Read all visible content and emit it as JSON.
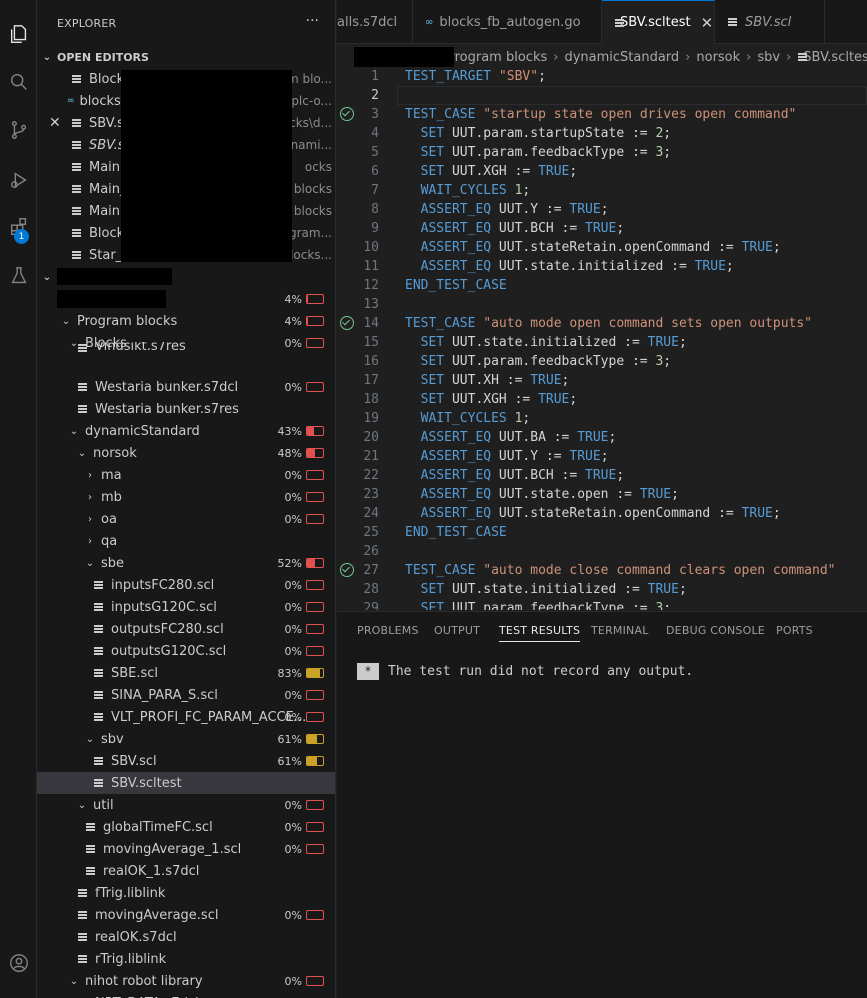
{
  "sidebar": {
    "title": "EXPLORER",
    "more": "···",
    "open_editors_title": "OPEN EDITORS",
    "open_editors": [
      {
        "name": "Block",
        "desc": "m blo...",
        "icon": "file"
      },
      {
        "name": "blocks",
        "desc": ".plc-o...",
        "icon": "go"
      },
      {
        "name": "SBV.sc",
        "desc": "ocks\\d...",
        "icon": "file",
        "close": "✕"
      },
      {
        "name": "SBV.sc",
        "desc": "ynami...",
        "icon": "file"
      },
      {
        "name": "Main.s",
        "desc": "ocks",
        "icon": "file"
      },
      {
        "name": "Main_",
        "desc": "n blocks",
        "icon": "file"
      },
      {
        "name": "Main c",
        "desc": "n blocks",
        "icon": "file"
      },
      {
        "name": "Block",
        "desc": "rogram...",
        "icon": "file"
      },
      {
        "name": "Star_d",
        "desc": "blocks...",
        "icon": "file"
      }
    ],
    "tree": [
      {
        "label": "",
        "pct": "4%",
        "fill": 0.04,
        "color": "red",
        "twisty": "⌄",
        "indent": 16
      },
      {
        "label": "Program blocks",
        "pct": "4%",
        "fill": 0.04,
        "color": "red",
        "twisty": "⌄",
        "indent": 22
      },
      {
        "label": "Blocks",
        "pct": "0%",
        "fill": 0,
        "color": "red",
        "twisty": "⌄",
        "indent": 30
      },
      {
        "label": "Vindsikt.s7res",
        "pct": "",
        "indent": 40,
        "file": true,
        "partial": true
      },
      {
        "label": "Westaria bunker.s7dcl",
        "pct": "0%",
        "fill": 0,
        "color": "red",
        "indent": 40,
        "file": true
      },
      {
        "label": "Westaria bunker.s7res",
        "pct": "",
        "indent": 40,
        "file": true
      },
      {
        "label": "dynamicStandard",
        "pct": "43%",
        "fill": 0.43,
        "color": "red",
        "twisty": "⌄",
        "indent": 30
      },
      {
        "label": "norsok",
        "pct": "48%",
        "fill": 0.48,
        "color": "red",
        "twisty": "⌄",
        "indent": 38
      },
      {
        "label": "ma",
        "pct": "0%",
        "fill": 0,
        "color": "red",
        "twisty": "›",
        "indent": 46
      },
      {
        "label": "mb",
        "pct": "0%",
        "fill": 0,
        "color": "red",
        "twisty": "›",
        "indent": 46
      },
      {
        "label": "oa",
        "pct": "0%",
        "fill": 0,
        "color": "red",
        "twisty": "›",
        "indent": 46
      },
      {
        "label": "qa",
        "pct": "",
        "twisty": "›",
        "indent": 46
      },
      {
        "label": "sbe",
        "pct": "52%",
        "fill": 0.52,
        "color": "red",
        "twisty": "⌄",
        "indent": 46
      },
      {
        "label": "inputsFC280.scl",
        "pct": "0%",
        "fill": 0,
        "color": "red",
        "indent": 56,
        "file": true
      },
      {
        "label": "inputsG120C.scl",
        "pct": "0%",
        "fill": 0,
        "color": "red",
        "indent": 56,
        "file": true
      },
      {
        "label": "outputsFC280.scl",
        "pct": "0%",
        "fill": 0,
        "color": "red",
        "indent": 56,
        "file": true
      },
      {
        "label": "outputsG120C.scl",
        "pct": "0%",
        "fill": 0,
        "color": "red",
        "indent": 56,
        "file": true
      },
      {
        "label": "SBE.scl",
        "pct": "83%",
        "fill": 0.83,
        "color": "yellow",
        "indent": 56,
        "file": true
      },
      {
        "label": "SINA_PARA_S.scl",
        "pct": "0%",
        "fill": 0,
        "color": "red",
        "indent": 56,
        "file": true
      },
      {
        "label": "VLT_PROFI_FC_PARAM_ACCE...",
        "pct": "0%",
        "fill": 0,
        "color": "red",
        "indent": 56,
        "file": true
      },
      {
        "label": "sbv",
        "pct": "61%",
        "fill": 0.61,
        "color": "yellow",
        "twisty": "⌄",
        "indent": 46
      },
      {
        "label": "SBV.scl",
        "pct": "61%",
        "fill": 0.61,
        "color": "yellow",
        "indent": 56,
        "file": true
      },
      {
        "label": "SBV.scltest",
        "pct": "",
        "indent": 56,
        "file": true,
        "selected": true
      },
      {
        "label": "util",
        "pct": "0%",
        "fill": 0,
        "color": "red",
        "twisty": "⌄",
        "indent": 38
      },
      {
        "label": "globalTimeFC.scl",
        "pct": "0%",
        "fill": 0,
        "color": "red",
        "indent": 48,
        "file": true
      },
      {
        "label": "movingAverage_1.scl",
        "pct": "0%",
        "fill": 0,
        "color": "red",
        "indent": 48,
        "file": true
      },
      {
        "label": "realOK_1.s7dcl",
        "pct": "",
        "indent": 48,
        "file": true
      },
      {
        "label": "fTrig.liblink",
        "pct": "",
        "indent": 40,
        "file": true
      },
      {
        "label": "movingAverage.scl",
        "pct": "0%",
        "fill": 0,
        "color": "red",
        "indent": 40,
        "file": true
      },
      {
        "label": "realOK.s7dcl",
        "pct": "",
        "indent": 40,
        "file": true
      },
      {
        "label": "rTrig.liblink",
        "pct": "",
        "indent": 40,
        "file": true
      },
      {
        "label": "nihot robot library",
        "pct": "0%",
        "fill": 0,
        "color": "red",
        "twisty": "⌄",
        "indent": 30
      },
      {
        "label": "NRT_DATA.s7dcl",
        "pct": "0%",
        "fill": 0,
        "color": "red",
        "indent": 40,
        "file": true,
        "partial": true
      }
    ]
  },
  "tabs": [
    {
      "label": "alls.s7dcl",
      "icon": ""
    },
    {
      "label": "blocks_fb_autogen.go",
      "icon": "go"
    },
    {
      "label": "SBV.scltest",
      "icon": "file",
      "active": true,
      "close": "✕"
    },
    {
      "label": "SBV.scl",
      "icon": "file",
      "italic": true
    }
  ],
  "breadcrumb": [
    "Program blocks",
    "dynamicStandard",
    "norsok",
    "sbv",
    "SBV.scltest"
  ],
  "code": [
    {
      "n": "1",
      "t": [
        [
          "kw",
          "TEST_TARGET"
        ],
        [
          "tx",
          " "
        ],
        [
          "str",
          "\"SBV\""
        ],
        [
          "tx",
          ";"
        ]
      ]
    },
    {
      "n": "2",
      "t": [],
      "cur": true
    },
    {
      "n": "3",
      "check": true,
      "t": [
        [
          "kw",
          "TEST_CASE"
        ],
        [
          "tx",
          " "
        ],
        [
          "str",
          "\"startup state open drives open command\""
        ]
      ]
    },
    {
      "n": "4",
      "t": [
        [
          "tx",
          "  "
        ],
        [
          "kw",
          "SET"
        ],
        [
          "tx",
          " UUT.param.startupState := "
        ],
        [
          "nm",
          "2"
        ],
        [
          "tx",
          ";"
        ]
      ]
    },
    {
      "n": "5",
      "t": [
        [
          "tx",
          "  "
        ],
        [
          "kw",
          "SET"
        ],
        [
          "tx",
          " UUT.param.feedbackType := "
        ],
        [
          "nm",
          "3"
        ],
        [
          "tx",
          ";"
        ]
      ]
    },
    {
      "n": "6",
      "t": [
        [
          "tx",
          "  "
        ],
        [
          "kw",
          "SET"
        ],
        [
          "tx",
          " UUT.XGH := "
        ],
        [
          "cn",
          "TRUE"
        ],
        [
          "tx",
          ";"
        ]
      ]
    },
    {
      "n": "7",
      "t": [
        [
          "tx",
          "  "
        ],
        [
          "kw",
          "WAIT_CYCLES"
        ],
        [
          "tx",
          " "
        ],
        [
          "nm",
          "1"
        ],
        [
          "tx",
          ";"
        ]
      ]
    },
    {
      "n": "8",
      "t": [
        [
          "tx",
          "  "
        ],
        [
          "kw",
          "ASSERT_EQ"
        ],
        [
          "tx",
          " UUT.Y := "
        ],
        [
          "cn",
          "TRUE"
        ],
        [
          "tx",
          ";"
        ]
      ]
    },
    {
      "n": "9",
      "t": [
        [
          "tx",
          "  "
        ],
        [
          "kw",
          "ASSERT_EQ"
        ],
        [
          "tx",
          " UUT.BCH := "
        ],
        [
          "cn",
          "TRUE"
        ],
        [
          "tx",
          ";"
        ]
      ]
    },
    {
      "n": "10",
      "t": [
        [
          "tx",
          "  "
        ],
        [
          "kw",
          "ASSERT_EQ"
        ],
        [
          "tx",
          " UUT.stateRetain.openCommand := "
        ],
        [
          "cn",
          "TRUE"
        ],
        [
          "tx",
          ";"
        ]
      ]
    },
    {
      "n": "11",
      "t": [
        [
          "tx",
          "  "
        ],
        [
          "kw",
          "ASSERT_EQ"
        ],
        [
          "tx",
          " UUT.state.initialized := "
        ],
        [
          "cn",
          "TRUE"
        ],
        [
          "tx",
          ";"
        ]
      ]
    },
    {
      "n": "12",
      "t": [
        [
          "kw",
          "END_TEST_CASE"
        ]
      ]
    },
    {
      "n": "13",
      "t": []
    },
    {
      "n": "14",
      "check": true,
      "t": [
        [
          "kw",
          "TEST_CASE"
        ],
        [
          "tx",
          " "
        ],
        [
          "str",
          "\"auto mode open command sets open outputs\""
        ]
      ]
    },
    {
      "n": "15",
      "t": [
        [
          "tx",
          "  "
        ],
        [
          "kw",
          "SET"
        ],
        [
          "tx",
          " UUT.state.initialized := "
        ],
        [
          "cn",
          "TRUE"
        ],
        [
          "tx",
          ";"
        ]
      ]
    },
    {
      "n": "16",
      "t": [
        [
          "tx",
          "  "
        ],
        [
          "kw",
          "SET"
        ],
        [
          "tx",
          " UUT.param.feedbackType := "
        ],
        [
          "nm",
          "3"
        ],
        [
          "tx",
          ";"
        ]
      ]
    },
    {
      "n": "17",
      "t": [
        [
          "tx",
          "  "
        ],
        [
          "kw",
          "SET"
        ],
        [
          "tx",
          " UUT.XH := "
        ],
        [
          "cn",
          "TRUE"
        ],
        [
          "tx",
          ";"
        ]
      ]
    },
    {
      "n": "18",
      "t": [
        [
          "tx",
          "  "
        ],
        [
          "kw",
          "SET"
        ],
        [
          "tx",
          " UUT.XGH := "
        ],
        [
          "cn",
          "TRUE"
        ],
        [
          "tx",
          ";"
        ]
      ]
    },
    {
      "n": "19",
      "t": [
        [
          "tx",
          "  "
        ],
        [
          "kw",
          "WAIT_CYCLES"
        ],
        [
          "tx",
          " "
        ],
        [
          "nm",
          "1"
        ],
        [
          "tx",
          ";"
        ]
      ]
    },
    {
      "n": "20",
      "t": [
        [
          "tx",
          "  "
        ],
        [
          "kw",
          "ASSERT_EQ"
        ],
        [
          "tx",
          " UUT.BA := "
        ],
        [
          "cn",
          "TRUE"
        ],
        [
          "tx",
          ";"
        ]
      ]
    },
    {
      "n": "21",
      "t": [
        [
          "tx",
          "  "
        ],
        [
          "kw",
          "ASSERT_EQ"
        ],
        [
          "tx",
          " UUT.Y := "
        ],
        [
          "cn",
          "TRUE"
        ],
        [
          "tx",
          ";"
        ]
      ]
    },
    {
      "n": "22",
      "t": [
        [
          "tx",
          "  "
        ],
        [
          "kw",
          "ASSERT_EQ"
        ],
        [
          "tx",
          " UUT.BCH := "
        ],
        [
          "cn",
          "TRUE"
        ],
        [
          "tx",
          ";"
        ]
      ]
    },
    {
      "n": "23",
      "t": [
        [
          "tx",
          "  "
        ],
        [
          "kw",
          "ASSERT_EQ"
        ],
        [
          "tx",
          " UUT.state.open := "
        ],
        [
          "cn",
          "TRUE"
        ],
        [
          "tx",
          ";"
        ]
      ]
    },
    {
      "n": "24",
      "t": [
        [
          "tx",
          "  "
        ],
        [
          "kw",
          "ASSERT_EQ"
        ],
        [
          "tx",
          " UUT.stateRetain.openCommand := "
        ],
        [
          "cn",
          "TRUE"
        ],
        [
          "tx",
          ";"
        ]
      ]
    },
    {
      "n": "25",
      "t": [
        [
          "kw",
          "END_TEST_CASE"
        ]
      ]
    },
    {
      "n": "26",
      "t": []
    },
    {
      "n": "27",
      "check": true,
      "t": [
        [
          "kw",
          "TEST_CASE"
        ],
        [
          "tx",
          " "
        ],
        [
          "str",
          "\"auto mode close command clears open command\""
        ]
      ]
    },
    {
      "n": "28",
      "t": [
        [
          "tx",
          "  "
        ],
        [
          "kw",
          "SET"
        ],
        [
          "tx",
          " UUT.state.initialized := "
        ],
        [
          "cn",
          "TRUE"
        ],
        [
          "tx",
          ";"
        ]
      ]
    },
    {
      "n": "29",
      "t": [
        [
          "tx",
          "  "
        ],
        [
          "kw",
          "SET"
        ],
        [
          "tx",
          " UUT.param.feedbackType := "
        ],
        [
          "nm",
          "3"
        ],
        [
          "tx",
          ";"
        ]
      ]
    }
  ],
  "panel": {
    "tabs": [
      {
        "label": "PROBLEMS"
      },
      {
        "label": "OUTPUT"
      },
      {
        "label": "TEST RESULTS",
        "active": true
      },
      {
        "label": "TERMINAL"
      },
      {
        "label": "DEBUG CONSOLE"
      },
      {
        "label": "PORTS"
      }
    ],
    "star": "*",
    "message": "The test run did not record any output."
  },
  "activity": {
    "badge": "1"
  },
  "colors": {
    "accent": "#0078d4",
    "coverage_low": "#e05252",
    "coverage_mid": "#c9a227",
    "test_pass": "#73c991"
  }
}
